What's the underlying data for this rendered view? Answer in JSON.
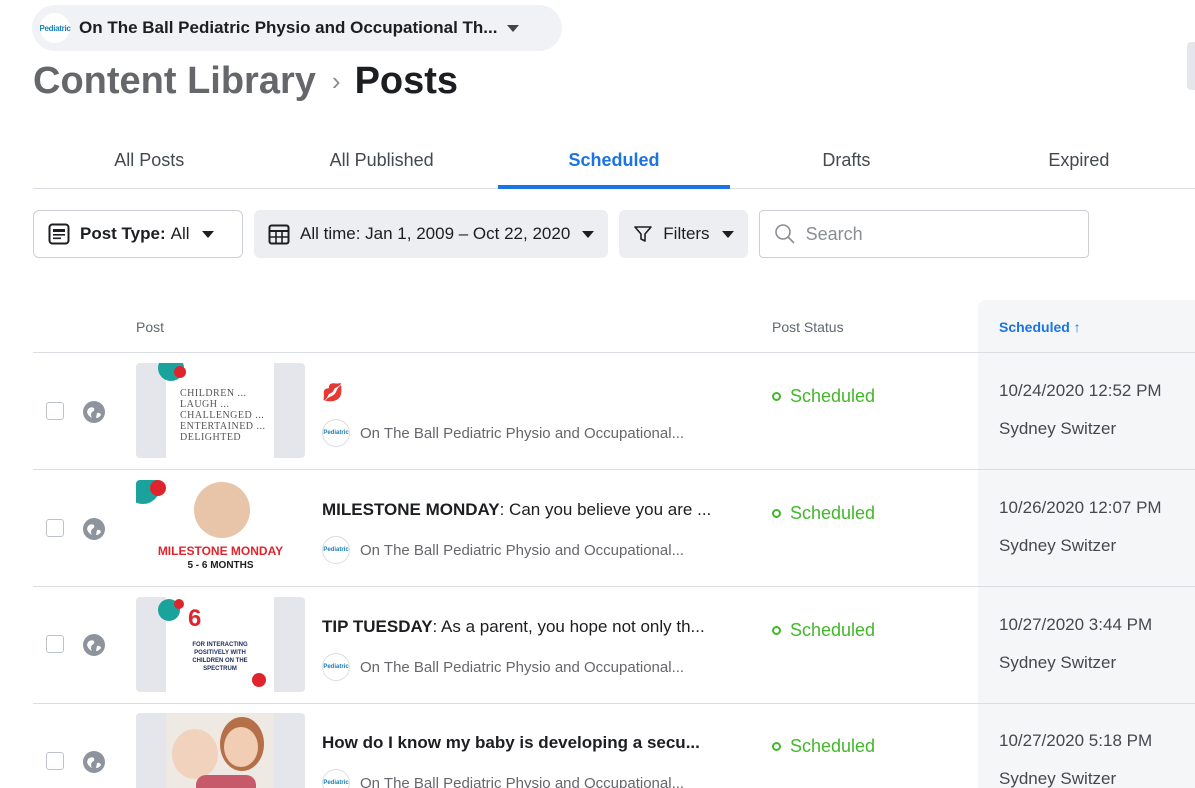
{
  "page_selector": {
    "logo_text": "Pediatric",
    "name": "On The Ball Pediatric Physio and Occupational Th..."
  },
  "breadcrumb": {
    "parent": "Content Library",
    "separator": "›",
    "current": "Posts"
  },
  "tabs": [
    {
      "label": "All Posts",
      "active": false
    },
    {
      "label": "All Published",
      "active": false
    },
    {
      "label": "Scheduled",
      "active": true
    },
    {
      "label": "Drafts",
      "active": false
    },
    {
      "label": "Expired",
      "active": false
    }
  ],
  "filters": {
    "post_type_label": "Post Type:",
    "post_type_value": "All",
    "date_range": "All time: Jan 1, 2009 – Oct 22, 2020",
    "filters_label": "Filters",
    "search_placeholder": "Search"
  },
  "table": {
    "columns": {
      "post": "Post",
      "status": "Post Status",
      "scheduled": "Scheduled ↑"
    },
    "rows": [
      {
        "title_bold": "",
        "title_rest": "💋",
        "author": "On The Ball Pediatric Physio and Occupational...",
        "status": "Scheduled",
        "date": "10/24/2020 12:52 PM",
        "user": "Sydney Switzer",
        "thumb_text": "CHILDREN ... LAUGH ... CHALLENGED ... ENTERTAINED ... DELIGHTED"
      },
      {
        "title_bold": "MILESTONE MONDAY",
        "title_rest": ": Can you believe you are ...",
        "author": "On The Ball Pediatric Physio and Occupational...",
        "status": "Scheduled",
        "date": "10/26/2020 12:07 PM",
        "user": "Sydney Switzer",
        "thumb_text": "MILESTONE MONDAY",
        "thumb_sub": "5 - 6 MONTHS"
      },
      {
        "title_bold": "TIP TUESDAY",
        "title_rest": ": As a parent, you hope not only th...",
        "author": "On The Ball Pediatric Physio and Occupational...",
        "status": "Scheduled",
        "date": "10/27/2020 3:44 PM",
        "user": "Sydney Switzer",
        "thumb_text": "6",
        "thumb_sub": "FOR INTERACTING POSITIVELY WITH CHILDREN ON THE SPECTRUM"
      },
      {
        "title_bold": "How do I know my baby is developing a secu...",
        "title_rest": "",
        "author": "On The Ball Pediatric Physio and Occupational...",
        "status": "Scheduled",
        "date": "10/27/2020 5:18 PM",
        "user": "Sydney Switzer"
      }
    ]
  },
  "colors": {
    "accent": "#1b74e4",
    "status_green": "#42b72a",
    "brand_red": "#e0242e",
    "brand_teal": "#1aa39c"
  }
}
